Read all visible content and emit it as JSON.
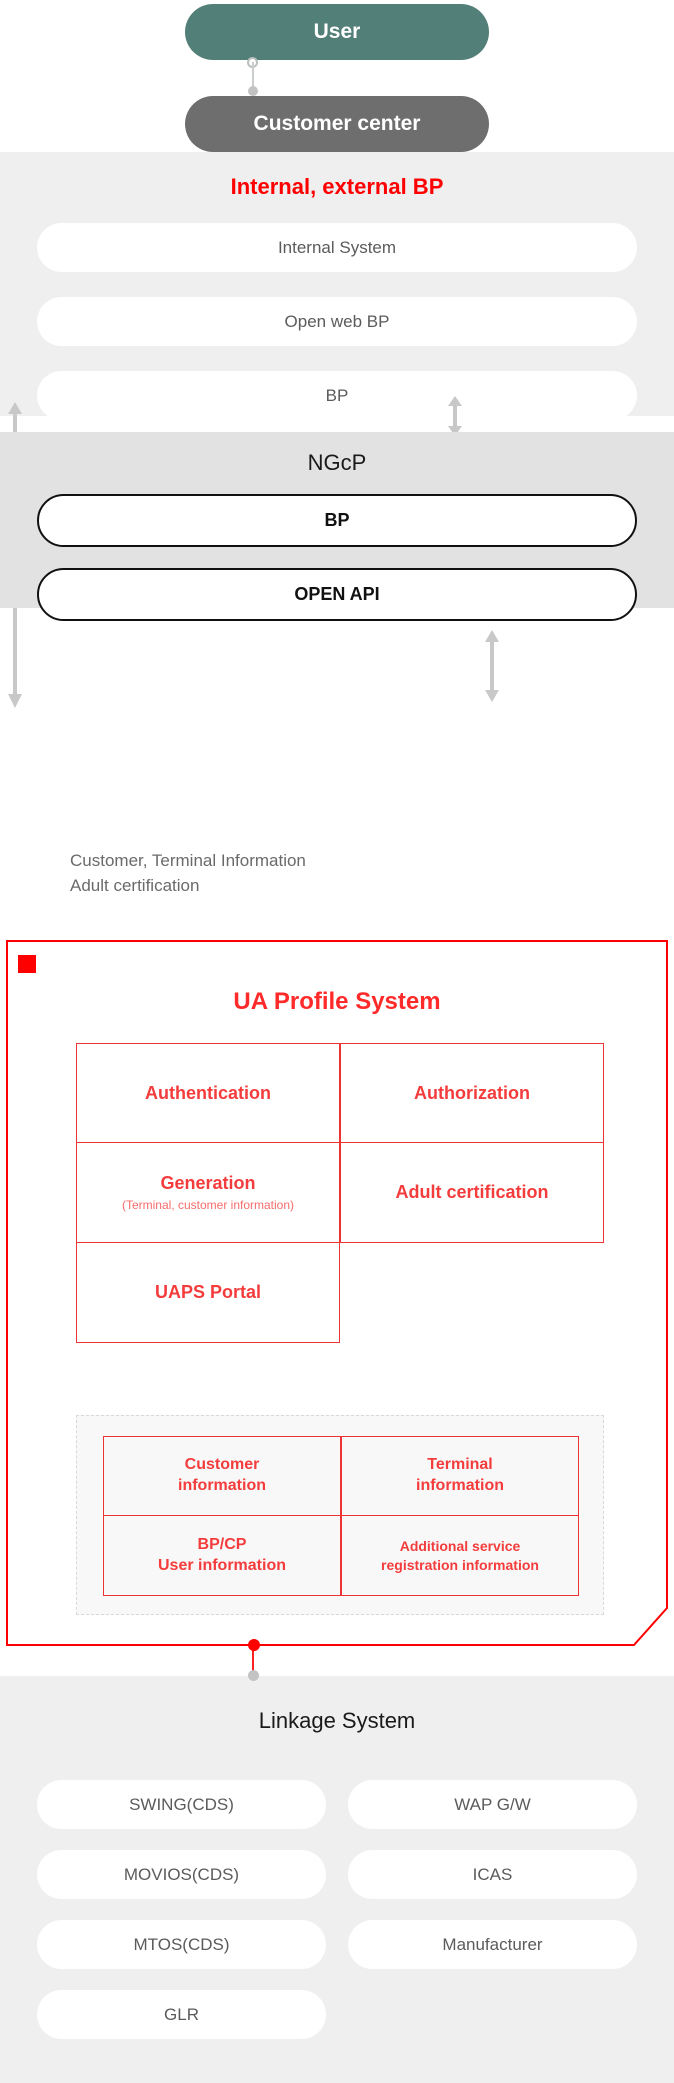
{
  "colors": {
    "user_pill": "#537f79",
    "customer_center_pill": "#6e6e6e",
    "accent_red": "#ff0000",
    "uaps_red": "#ff2a2a",
    "band_bp_bg": "#efefef",
    "band_ngcp_bg": "#e2e2e2",
    "band_link_bg": "#efefef",
    "arrow_grey": "#c8c8c8"
  },
  "actors": {
    "user": "User",
    "customer_center": "Customer center"
  },
  "bp_band": {
    "title": "Internal, external BP",
    "items": [
      "Internal System",
      "Open web BP",
      "BP"
    ]
  },
  "ngcp_band": {
    "title": "NGcP",
    "items": [
      "BP",
      "OPEN API"
    ]
  },
  "flow": {
    "label": "Customer, Terminal Information\nAdult certification"
  },
  "uaps": {
    "title": "UA Profile System",
    "functions": [
      {
        "main": "Authentication",
        "sub": ""
      },
      {
        "main": "Authorization",
        "sub": ""
      },
      {
        "main": "Generation",
        "sub": "(Terminal, customer information)"
      },
      {
        "main": "Adult certification",
        "sub": ""
      },
      {
        "main": "UAPS Portal",
        "sub": ""
      }
    ],
    "data_items": [
      "Customer\ninformation",
      "Terminal\ninformation",
      "BP/CP\nUser information",
      "Additional service\nregistration information"
    ]
  },
  "linkage_band": {
    "title": "Linkage System",
    "left_items": [
      "SWING(CDS)",
      "MOVIOS(CDS)",
      "MTOS(CDS)",
      "GLR"
    ],
    "right_items": [
      "WAP G/W",
      "ICAS",
      "Manufacturer"
    ]
  },
  "icons": {
    "arrow_up_left": "arrow-up-icon",
    "arrow_down_left": "arrow-down-icon",
    "arrow_double_right_top": "arrow-up-down-icon",
    "arrow_double_right_bottom": "arrow-up-down-icon",
    "uaps_marker": "red-square-marker-icon",
    "connector_ring": "connector-ring-icon",
    "connector_dot": "connector-dot-icon"
  }
}
